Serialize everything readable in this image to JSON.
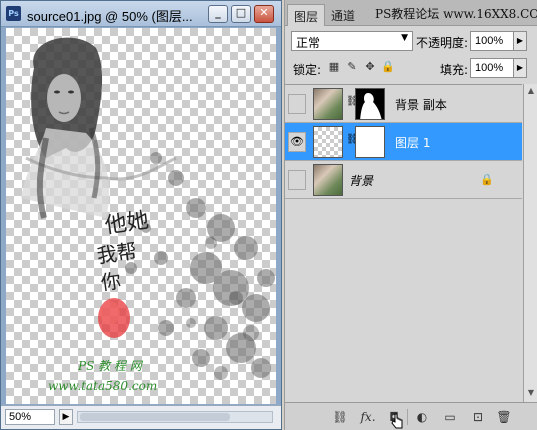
{
  "document_window": {
    "app_badge": "Ps",
    "title": "source01.jpg @ 50% (图层...",
    "buttons": {
      "minimize": "_",
      "maximize": "□",
      "close": "✕"
    },
    "artwork_text": {
      "calligraphy_line1": "他她",
      "calligraphy_line2": "我帮",
      "calligraphy_line3": "你",
      "watermark_cn": "PS 教 程 网",
      "watermark_url": "www.tata580.com"
    },
    "status": {
      "zoom": "50%",
      "nav_glyph": "▶"
    }
  },
  "layers_panel": {
    "tabs": [
      {
        "label": "图层",
        "active": true
      },
      {
        "label": "通道",
        "active": false
      }
    ],
    "top_watermark": "PS教程论坛 www.16XX8.COM",
    "blend_mode": "正常",
    "opacity_label": "不透明度:",
    "opacity_value": "100%",
    "lock_label": "锁定:",
    "fill_label": "填充:",
    "fill_value": "100%",
    "layers": [
      {
        "name": "背景 副本",
        "visible": false,
        "selected": false,
        "has_mask": true
      },
      {
        "name": "图层 1",
        "visible": true,
        "selected": true,
        "has_mask": true
      },
      {
        "name": "背景",
        "visible": false,
        "selected": false,
        "locked": true
      }
    ],
    "bottom_icons": [
      "link-layers-icon",
      "fx-icon",
      "add-mask-icon",
      "adjustment-layer-icon",
      "new-group-icon",
      "new-layer-icon",
      "trash-icon"
    ],
    "fx_label": "fx."
  }
}
